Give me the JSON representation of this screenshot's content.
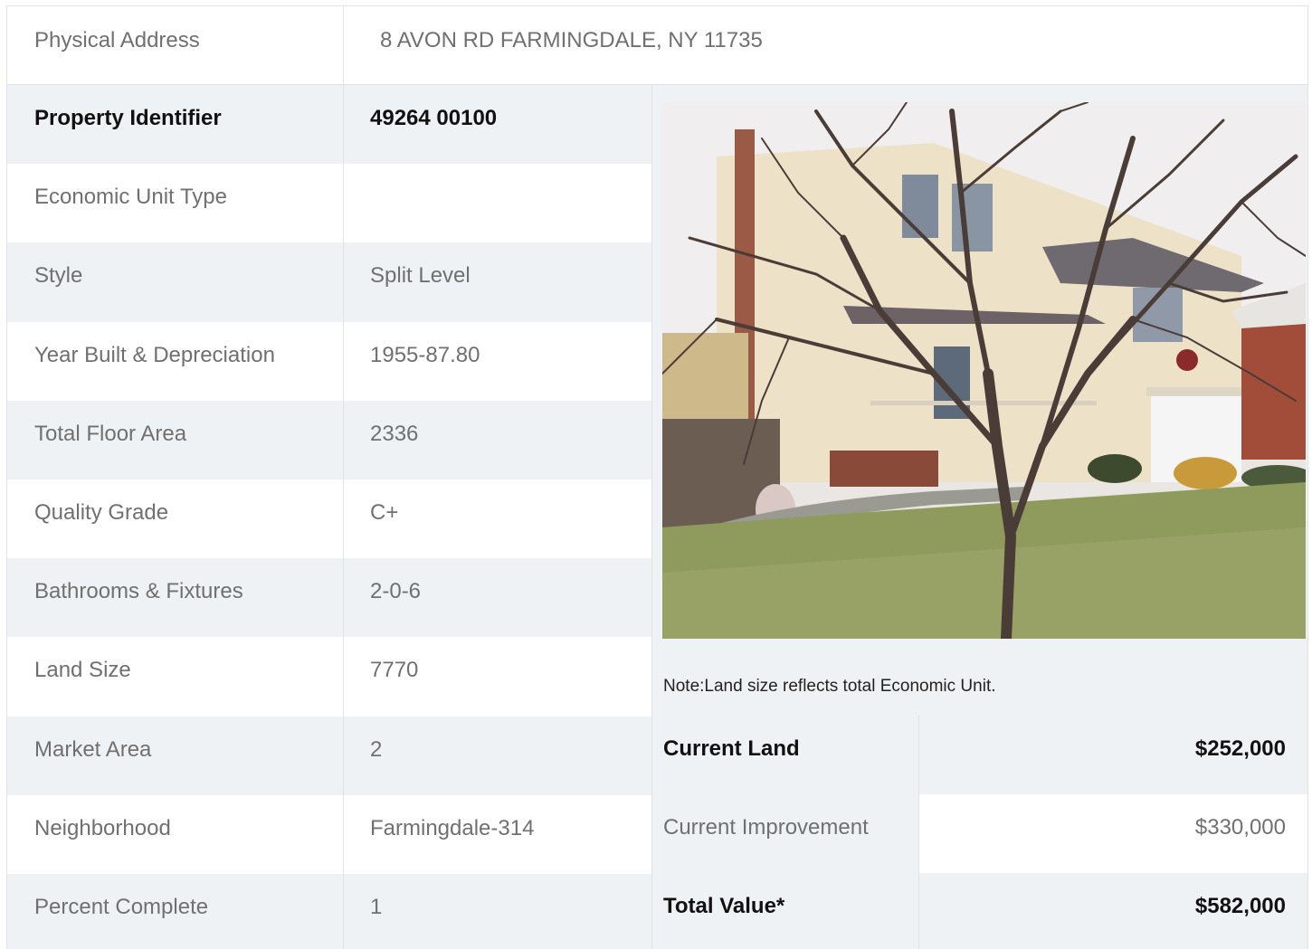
{
  "address": {
    "label": "Physical Address",
    "value": "8  AVON RD  FARMINGDALE, NY  11735"
  },
  "details": [
    {
      "label": "Property Identifier",
      "value": "49264  00100"
    },
    {
      "label": "Economic Unit Type",
      "value": ""
    },
    {
      "label": "Style",
      "value": "Split Level"
    },
    {
      "label": "Year Built & Depreciation",
      "value": "1955-87.80"
    },
    {
      "label": "Total Floor Area",
      "value": "2336"
    },
    {
      "label": "Quality Grade",
      "value": "C+"
    },
    {
      "label": "Bathrooms & Fixtures",
      "value": "2-0-6"
    },
    {
      "label": "Land Size",
      "value": "7770"
    },
    {
      "label": "Market Area",
      "value": "2"
    },
    {
      "label": "Neighborhood",
      "value": "Farmingdale-314"
    },
    {
      "label": "Percent Complete",
      "value": "1"
    }
  ],
  "photo": {
    "description": "property-photo"
  },
  "note": "Note:Land size reflects total Economic Unit.",
  "valuation": [
    {
      "label": "Current Land",
      "value": "$252,000"
    },
    {
      "label": "Current Improvement",
      "value": "$330,000"
    },
    {
      "label": "Total Value*",
      "value": "$582,000"
    }
  ],
  "colors": {
    "shade": "#eff2f5",
    "border": "#dfe3e8",
    "text": "#707070",
    "bold_text": "#111111"
  }
}
